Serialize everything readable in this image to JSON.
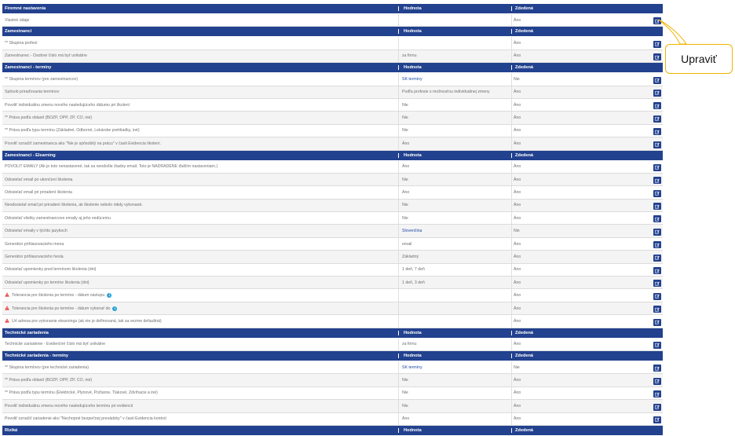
{
  "columns": {
    "value": "Hodnota",
    "inherited": "Zdedená"
  },
  "callout": {
    "label": "Upraviť"
  },
  "sections": [
    {
      "title": "Firemné nastavenia",
      "rows": [
        {
          "name": "Vlastné údaje",
          "value": "",
          "inherited": "Áno"
        }
      ]
    },
    {
      "title": "Zamestnanci",
      "rows": [
        {
          "name": "** Skupina profesí",
          "value": "",
          "inherited": "Áno"
        },
        {
          "name": "Zamestnanec - Osobné číslo má byť unikátne",
          "value": "za firmu",
          "inherited": "Áno"
        }
      ]
    },
    {
      "title": "Zamestnanci - termíny",
      "rows": [
        {
          "name": "** Skupina termínov (pre zamestnancov)",
          "value": "SK termíny",
          "value_link": true,
          "inherited": "Nie"
        },
        {
          "name": "Spôsob priraďovania termínov",
          "value": "Podľa profesie s možnosťou individuálnej zmeny",
          "inherited": "Áno"
        },
        {
          "name": "Povoliť individuálnu zmenu nového nasledujúceho dátumu pri školení",
          "value": "Nie",
          "inherited": "Áno"
        },
        {
          "name": "** Práva podľa oblastí (BOZP, OPP, ŽP, CO, iné)",
          "value": "Nie",
          "inherited": "Áno"
        },
        {
          "name": "** Práva podľa typu termínu (Základné, Odborné, Lekárske prehliadky, iné)",
          "value": "Nie",
          "inherited": "Áno"
        },
        {
          "name": "Povoliť označiť zamestnanca ako \"Nie je spôsobilý na prácu\" v časti Evidencia školení.",
          "value": "Áno",
          "inherited": "Áno"
        }
      ]
    },
    {
      "title": "Zamestnanci - Elearning",
      "rows": [
        {
          "name": "POVOLIŤ EMAILY (Ak je toto nenastavené, tak sa neodošle žiadny email. Toto je NADRADENÉ ďalším nastaveniam.)",
          "value": "Áno",
          "inherited": "Áno"
        },
        {
          "name": "Odosielať email po ukončení školenia",
          "value": "Nie",
          "inherited": "Áno"
        },
        {
          "name": "Odosielať email pri priradení školenia",
          "value": "Áno",
          "inherited": "Áno"
        },
        {
          "name": "Neodosielať email pri priradení školenia, ak školenie nebolo nikdy vykonané.",
          "value": "Nie",
          "inherited": "Áno"
        },
        {
          "name": "Odosielať všetky zamestnancove emaily aj jeho vedúcemu",
          "value": "Nie",
          "inherited": "Áno"
        },
        {
          "name": "Odosielať emaily v týchto jazykoch",
          "value": "Slovenčina",
          "value_link": true,
          "inherited": "Nie"
        },
        {
          "name": "Generátor prihlasovacieho mena",
          "value": "email",
          "inherited": "Áno"
        },
        {
          "name": "Generátor prihlasovacieho hesla",
          "value": "Základný",
          "inherited": "Áno"
        },
        {
          "name": "Odosielať upomienky pred termínom školenia (dni)",
          "value": "1 deň, 7 deň",
          "inherited": "Áno"
        },
        {
          "name": "Odosielať upomienky po termíne školenia (dni)",
          "value": "1 deň, 3 deň",
          "inherited": "Áno"
        },
        {
          "name": "Tolerancia pre školenia po termíne - dátum nástupu",
          "value": "",
          "inherited": "Áno",
          "warning": true,
          "info": true
        },
        {
          "name": "Tolerancia pre školenia po termíne - dátum vykonať do",
          "value": "",
          "inherited": "Áno",
          "warning": true,
          "info": true
        },
        {
          "name": "Url adresa pre vykonanie elearningu (ak nie je definovaná, tak sa vezme defaultná)",
          "value": "",
          "inherited": "Áno",
          "warning": true
        }
      ]
    },
    {
      "title": "Technické zariadenia",
      "rows": [
        {
          "name": "Technické zariadenie - Evidenčné číslo má byť unikátne",
          "value": "za firmu",
          "inherited": "Áno"
        }
      ]
    },
    {
      "title": "Technické zariadenia - termíny",
      "rows": [
        {
          "name": "** Skupina termínov (pre technické zariadenia)",
          "value": "SK termíny",
          "value_link": true,
          "inherited": "Nie"
        },
        {
          "name": "** Práva podľa oblastí (BOZP, OPP, ŽP, CO, iné)",
          "value": "Nie",
          "inherited": "Áno"
        },
        {
          "name": "** Práva podľa typu termínu (Elektrické, Plynové, Požiarne, Tlakové, Zdvíhacie a iné)",
          "value": "Nie",
          "inherited": "Áno"
        },
        {
          "name": "Povoliť individuálnu zmenu nového nasledujúceho termínu pri evidencii",
          "value": "Nie",
          "inherited": "Áno"
        },
        {
          "name": "Povoliť označiť zariadenie ako \"Nechopné bezpečnej prevádzky\" v časti Evidencia kontrol",
          "value": "Áno",
          "inherited": "Áno"
        }
      ]
    },
    {
      "title": "Riziká",
      "rows": []
    }
  ]
}
